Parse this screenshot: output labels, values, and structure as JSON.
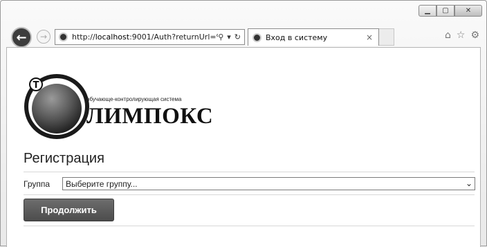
{
  "browser": {
    "url_prefix": "http://",
    "url_host": "localhost",
    "url_rest": ":9001/Auth?returnUrl=%",
    "tab_title": "Вход в систему",
    "tab_close": "×",
    "search_icon": "⚲",
    "dropdown_icon": "▾",
    "refresh_icon": "↻"
  },
  "logo": {
    "subtitle": "обучающе-контролирующая система",
    "name": "ЛИМПОКС"
  },
  "page": {
    "heading": "Регистрация",
    "group_label": "Группа",
    "group_select_value": "Выберите группу...",
    "continue_button": "Продолжить"
  }
}
